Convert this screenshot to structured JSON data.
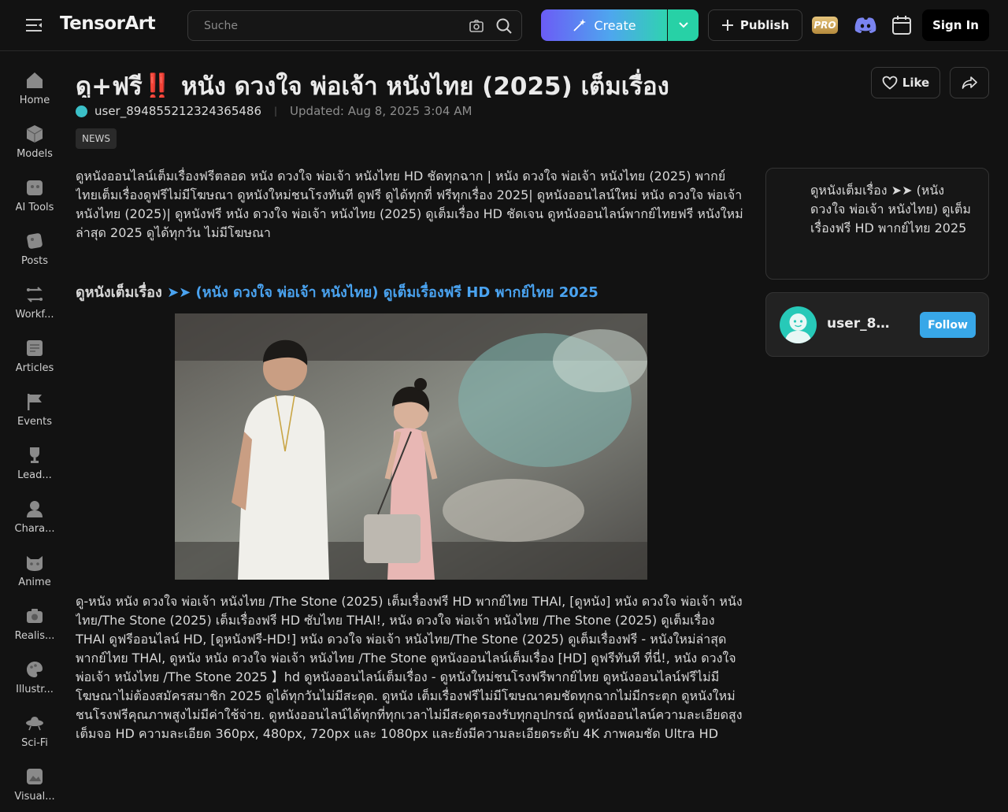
{
  "header": {
    "logo_text": "TensorArt",
    "search_placeholder": "Suche",
    "create_label": "Create",
    "publish_label": "Publish",
    "pro_label": "PRO",
    "signin_label": "Sign In"
  },
  "sidebar": {
    "items": [
      {
        "label": "Home",
        "icon": "home-icon"
      },
      {
        "label": "Models",
        "icon": "cube-icon"
      },
      {
        "label": "AI Tools",
        "icon": "ai-tools-icon"
      },
      {
        "label": "Posts",
        "icon": "posts-icon"
      },
      {
        "label": "Workf...",
        "icon": "workflow-icon"
      },
      {
        "label": "Articles",
        "icon": "articles-icon"
      },
      {
        "label": "Events",
        "icon": "flag-icon"
      },
      {
        "label": "Lead...",
        "icon": "trophy-icon"
      },
      {
        "label": "Chara...",
        "icon": "character-icon"
      },
      {
        "label": "Anime",
        "icon": "anime-icon"
      },
      {
        "label": "Realis...",
        "icon": "camera-icon"
      },
      {
        "label": "Illustr...",
        "icon": "palette-icon"
      },
      {
        "label": "Sci-Fi",
        "icon": "ufo-icon"
      },
      {
        "label": "Visual...",
        "icon": "visual-icon"
      }
    ]
  },
  "article": {
    "title": "ดู+ฟรี‼️ หนัง ดวงใจ พ่อเจ้า หนังไทย (2025) เต็มเรื่อง",
    "author": "user_894855212324365486",
    "updated": "Updated: Aug 8, 2025 3:04 AM",
    "tag": "NEWS",
    "like_label": "Like",
    "paragraph1": "ดูหนังออนไลน์เต็มเรื่องฟรีตลอด หนัง ดวงใจ พ่อเจ้า หนังไทย HD ชัดทุกฉาก | หนัง ดวงใจ พ่อเจ้า หนังไทย (2025) พากย์ไทยเต็มเรื่องดูฟรีไม่มีโฆษณา ดูหนังใหม่ชนโรงทันที ดูฟรี ดูได้ทุกที่ ฟรีทุกเรื่อง 2025| ดูหนังออนไลน์ใหม่ หนัง ดวงใจ พ่อเจ้า หนังไทย (2025)| ดูหนังฟรี หนัง ดวงใจ พ่อเจ้า หนังไทย (2025) ดูเต็มเรื่อง HD ชัดเจน ดูหนังออนไลน์พากย์ไทยฟรี หนังใหม่ล่าสุด 2025 ดูได้ทุกวัน ไม่มีโฆษณา",
    "link_prefix": "ดูหนังเต็มเรื่อง",
    "link_text": "➤➤ (หนัง ดวงใจ พ่อเจ้า หนังไทย) ดูเต็มเรื่องฟรี HD พากย์ไทย 2025",
    "paragraph2": "ดู-หนัง หนัง ดวงใจ พ่อเจ้า หนังไทย /The Stone (2025) เต็มเรื่องฟรี HD พากย์ไทย THAI, [ดูหนัง] หนัง ดวงใจ พ่อเจ้า หนังไทย/The Stone (2025) เต็มเรื่องฟรี HD ซับไทย THAI!, หนัง ดวงใจ พ่อเจ้า หนังไทย /The Stone (2025) ดูเต็มเรื่อง THAI ดูฟรีออนไลน์ HD, [ดูหนังฟรี-HD!] หนัง ดวงใจ พ่อเจ้า หนังไทย/The Stone (2025) ดูเต็มเรื่องฟรี - หนังใหม่ล่าสุดพากย์ไทย THAI, ดูหนัง หนัง ดวงใจ พ่อเจ้า หนังไทย /The Stone ดูหนังออนไลน์เต็มเรื่อง [HD] ดูฟรีทันที ที่นี่!, หนัง ดวงใจ พ่อเจ้า หนังไทย /The Stone 2025 】hd ดูหนังออนไลน์เต็มเรื่อง - ดูหนังใหม่ชนโรงฟรีพากย์ไทย ดูหนังออนไลน์ฟรีไม่มีโฆษณาไม่ต้องสมัครสมาชิก 2025 ดูได้ทุกวันไม่มีสะดุด. ดูหนัง เต็มเรื่องฟรีไม่มีโฆษณาคมชัดทุกฉากไม่มีกระตุก ดูหนังใหม่ชนโรงฟรีคุณภาพสูงไม่มีค่าใช้จ่าย. ดูหนังออนไลน์ได้ทุกที่ทุกเวลาไม่มีสะดุดรองรับทุกอุปกรณ์ ดูหนังออนไลน์ความละเอียดสูงเต็มจอ HD ความละเอียด 360px, 480px, 720px และ 1080px และยังมีความละเอียดระดับ 4K ภาพคมชัด Ultra HD"
  },
  "side_card": {
    "text": "ดูหนังเต็มเรื่อง ➤➤ (หนัง ดวงใจ พ่อเจ้า หนังไทย) ดูเต็มเรื่องฟรี HD พากย์ไทย 2025"
  },
  "author_card": {
    "name": "user_8948...",
    "follow_label": "Follow"
  },
  "colors": {
    "background": "#121212",
    "accent_blue": "#38a7e8",
    "link_blue": "#4aa3f0",
    "create_gradient_start": "#6b5cf6",
    "create_gradient_end": "#2fd3b0"
  }
}
